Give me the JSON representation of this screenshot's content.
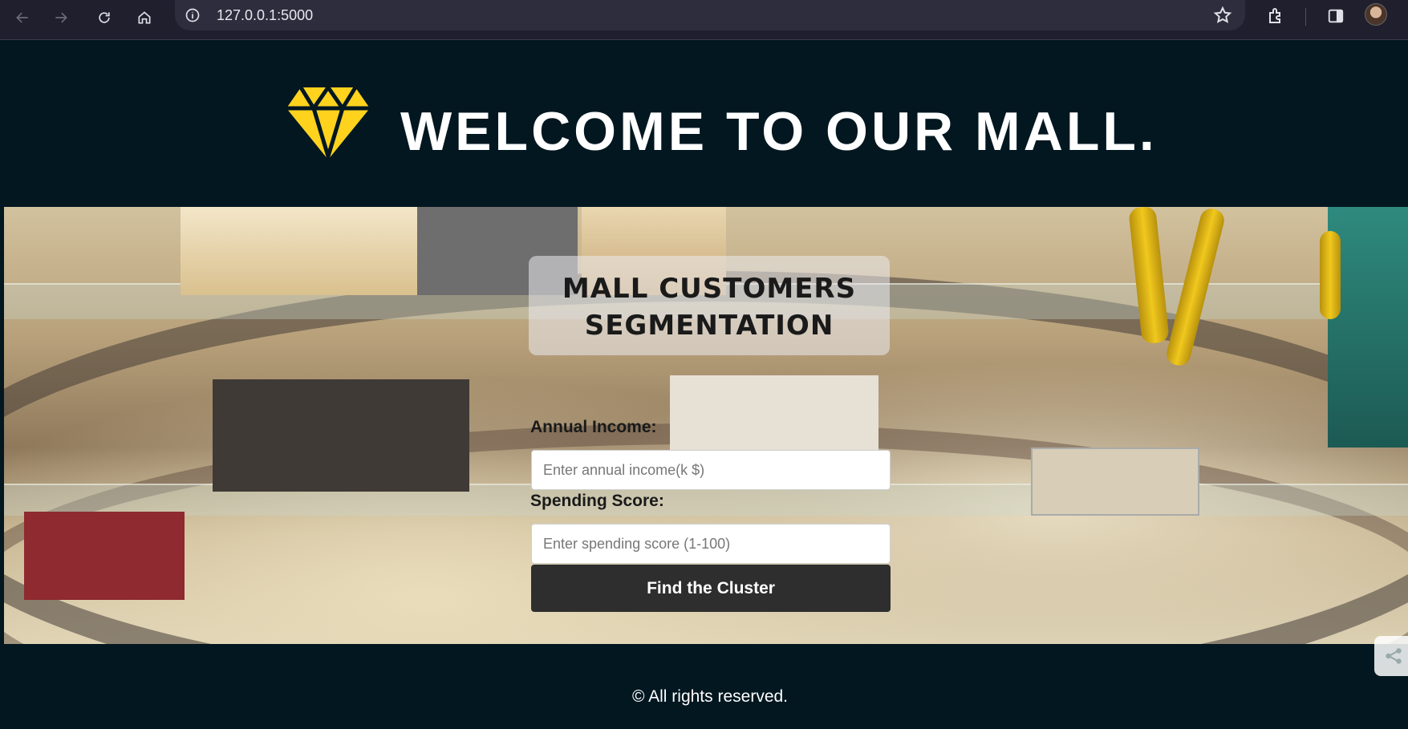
{
  "browser": {
    "url": "127.0.0.1:5000",
    "icons": [
      "back-arrow-icon",
      "forward-arrow-icon",
      "reload-icon",
      "home-icon",
      "info-icon",
      "star-icon",
      "extensions-icon",
      "sidebar-icon",
      "profile-avatar"
    ]
  },
  "header": {
    "title": "WELCOME TO OUR MALL.",
    "logo_icon": "diamond-icon",
    "logo_color": "#FFD21E"
  },
  "form": {
    "title_line1": "MALL CUSTOMERS",
    "title_line2": "SEGMENTATION",
    "income_label": "Annual Income:",
    "income_placeholder": "Enter annual income(k $)",
    "income_value": "",
    "score_label": "Spending Score:",
    "score_placeholder": "Enter spending score (1-100)",
    "score_value": "",
    "submit_label": "Find the Cluster"
  },
  "footer": {
    "copyright": "© All rights reserved."
  },
  "colors": {
    "page_bg": "#021720",
    "button_bg": "#2E2E2E",
    "accent_yellow": "#FFD21E"
  }
}
